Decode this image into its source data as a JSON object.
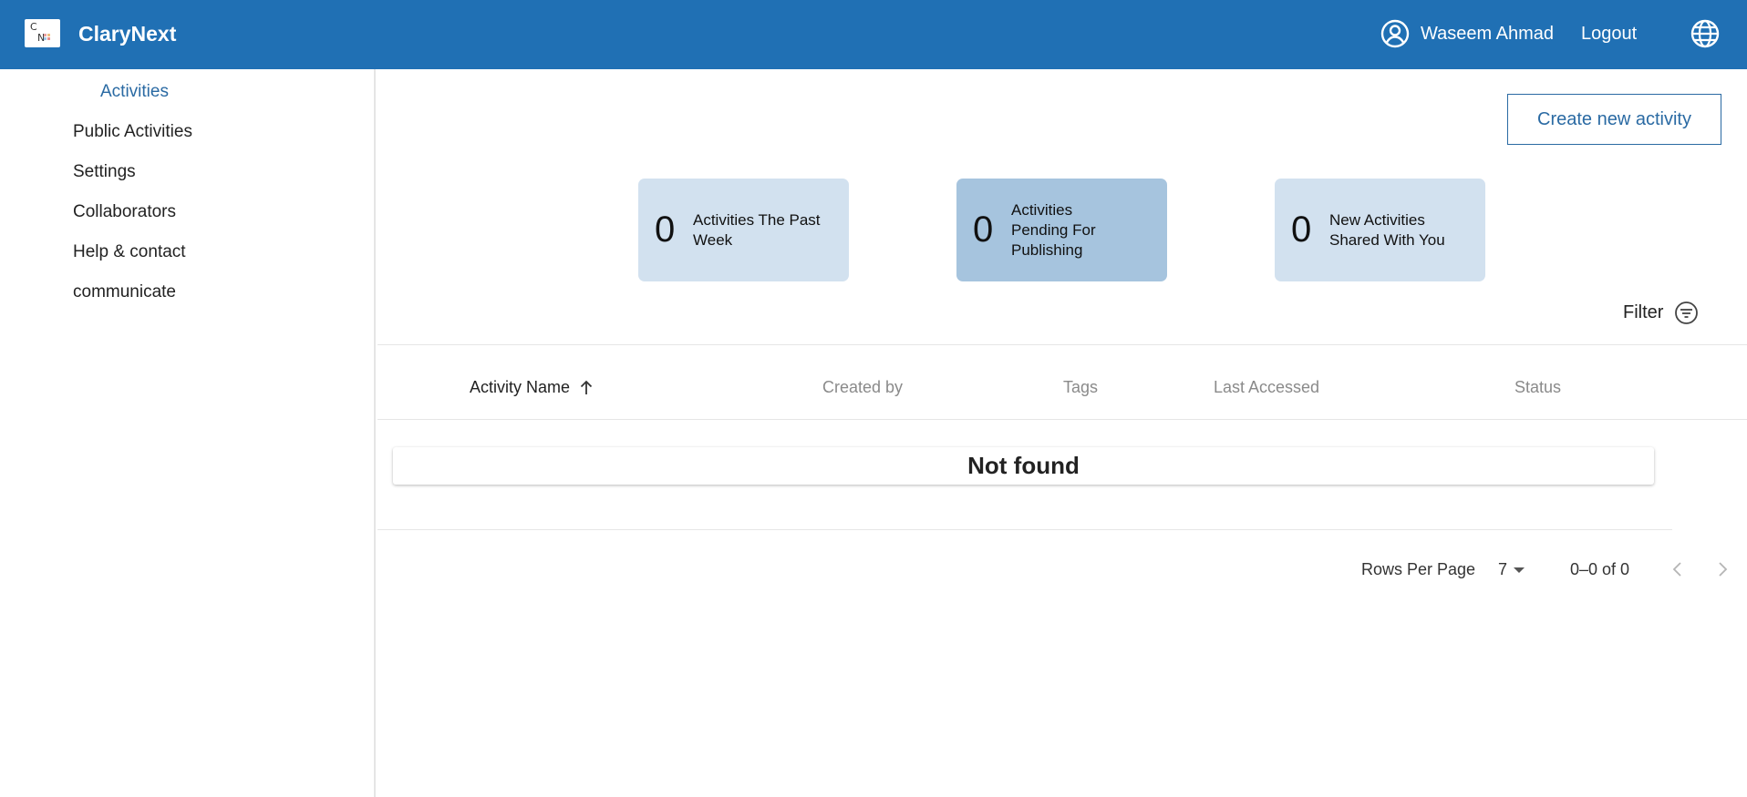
{
  "header": {
    "logo_letters": [
      "C",
      "N"
    ],
    "brand": "ClaryNext",
    "user_name": "Waseem Ahmad",
    "logout_label": "Logout",
    "background_color": "#2070b4"
  },
  "sidebar": {
    "items": [
      {
        "label": "Activities",
        "active": true
      },
      {
        "label": "Public Activities"
      },
      {
        "label": "Settings"
      },
      {
        "label": "Collaborators"
      },
      {
        "label": "Help & contact"
      },
      {
        "label": "communicate"
      }
    ],
    "active_color": "#2a6aa3"
  },
  "main": {
    "create_button_label": "Create new activity",
    "stat_cards": [
      {
        "value": "0",
        "label": "Activities The Past Week"
      },
      {
        "value": "0",
        "label": "Activities Pending For Publishing"
      },
      {
        "value": "0",
        "label": "New Activities Shared With You"
      }
    ],
    "filter_label": "Filter",
    "table": {
      "columns": [
        "Activity Name",
        "Created by",
        "Tags",
        "Last Accessed",
        "Status"
      ],
      "sorted_column": "Activity Name",
      "empty_message": "Not found"
    },
    "pagination": {
      "rows_per_page_label": "Rows Per Page",
      "rows_per_page_value": "7",
      "range_text": "0–0 of 0"
    }
  }
}
